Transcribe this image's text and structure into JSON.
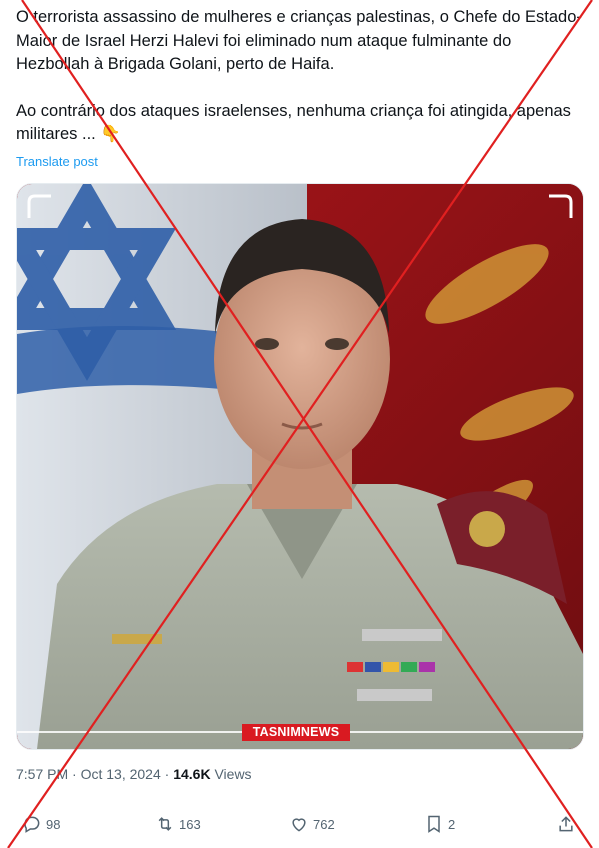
{
  "tweet": {
    "paragraph1": "O terrorista assassino de mulheres e crianças palestinas, o Chefe do Estado-Maior de Israel Herzi Halevi foi eliminado num ataque fulminante do Hezbollah à Brigada Golani, perto de Haifa.",
    "paragraph2": "Ao contrário dos ataques israelenses, nenhuma criança foi atingida, apenas militares ... 👇",
    "translate_label": "Translate post"
  },
  "media": {
    "watermark": "TASNIMNEWS",
    "subject": "portrait-photo"
  },
  "meta": {
    "time": "7:57 PM",
    "separator1": " · ",
    "date": "Oct 13, 2024",
    "separator2": " · ",
    "views_count": "14.6K",
    "views_label": " Views"
  },
  "actions": {
    "replies": "98",
    "reposts": "163",
    "likes": "762",
    "bookmarks": "2"
  },
  "colors": {
    "link": "#1d9bf0",
    "secondary_text": "#536471",
    "overlay_cross": "#e02020",
    "watermark_bg": "#d91a21"
  }
}
